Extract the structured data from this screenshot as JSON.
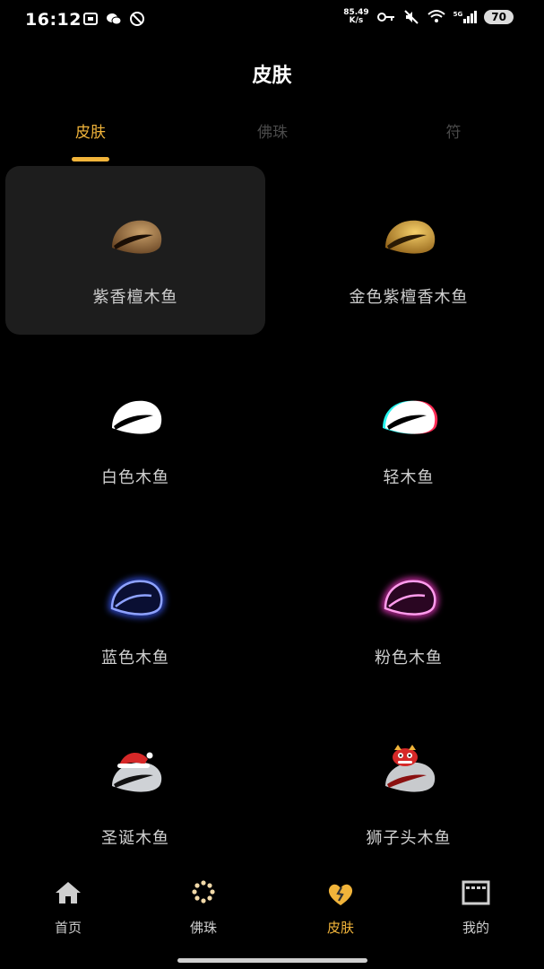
{
  "status_bar": {
    "time": "16:12",
    "speed_value": "85.49",
    "speed_unit": "K/s",
    "network": "5G",
    "battery": "70"
  },
  "page": {
    "title": "皮肤"
  },
  "tabs": [
    {
      "label": "皮肤",
      "active": true
    },
    {
      "label": "佛珠",
      "active": false
    },
    {
      "label": "符",
      "active": false
    }
  ],
  "skins": [
    {
      "label": "紫香檀木鱼",
      "selected": true,
      "style": "wood-brown"
    },
    {
      "label": "金色紫檀香木鱼",
      "selected": false,
      "style": "wood-gold"
    },
    {
      "label": "白色木鱼",
      "selected": false,
      "style": "white"
    },
    {
      "label": "轻木鱼",
      "selected": false,
      "style": "glitch"
    },
    {
      "label": "蓝色木鱼",
      "selected": false,
      "style": "neon-blue"
    },
    {
      "label": "粉色木鱼",
      "selected": false,
      "style": "neon-pink"
    },
    {
      "label": "圣诞木鱼",
      "selected": false,
      "style": "christmas"
    },
    {
      "label": "狮子头木鱼",
      "selected": false,
      "style": "lion-head"
    }
  ],
  "bottom_nav": [
    {
      "label": "首页",
      "icon": "home-icon",
      "active": false
    },
    {
      "label": "佛珠",
      "icon": "beads-icon",
      "active": false
    },
    {
      "label": "皮肤",
      "icon": "broken-heart-icon",
      "active": true
    },
    {
      "label": "我的",
      "icon": "profile-box-icon",
      "active": false
    }
  ],
  "colors": {
    "accent": "#f1b43a",
    "background": "#000000",
    "card_selected": "#1d1d1d",
    "tab_inactive": "#4a4a4a",
    "neon_blue": "#3a5cff",
    "neon_pink": "#ff3ad0"
  }
}
